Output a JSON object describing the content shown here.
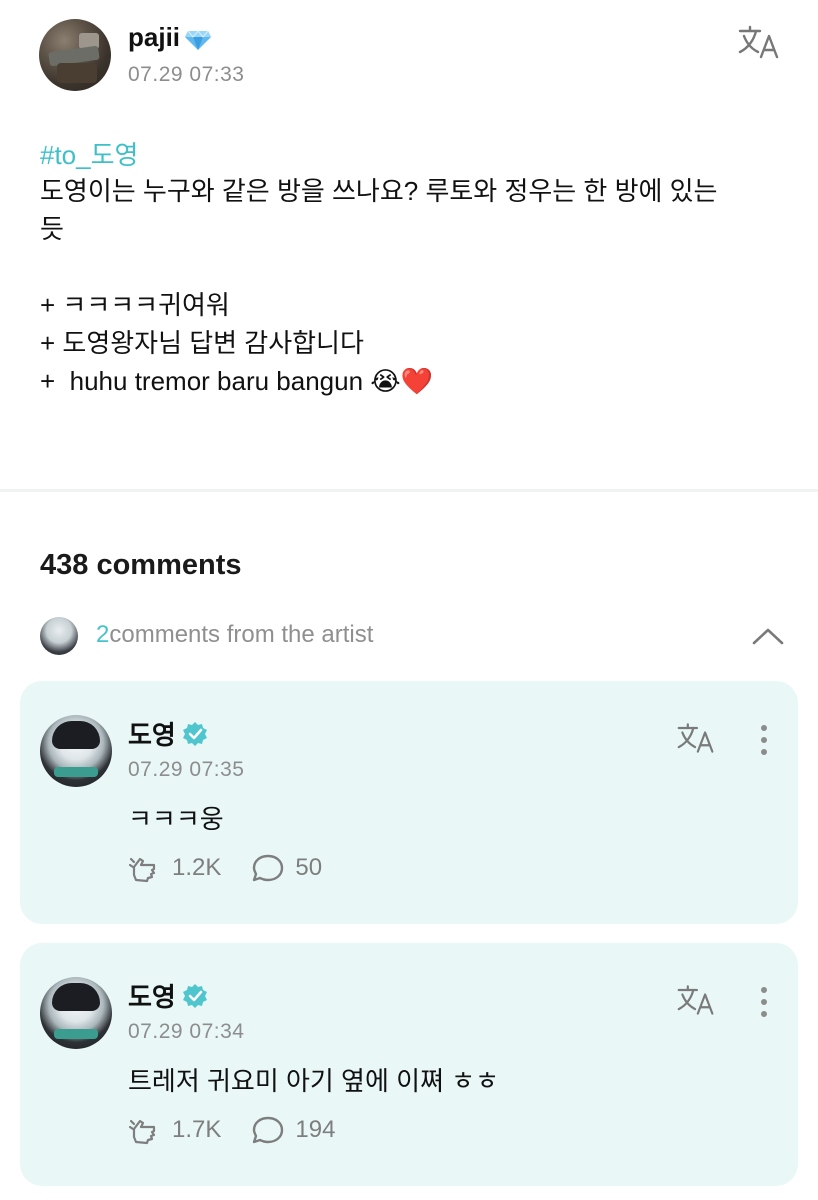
{
  "post": {
    "username": "pajii",
    "badge_icon": "diamond-gem-icon",
    "timestamp": "07.29 07:33",
    "hashtag": "#to_도영",
    "body_lines": [
      "도영이는 누구와 같은 방을 쓰나요? 루토와 정우는 한 방에 있는",
      "듯",
      "",
      "+ ㅋㅋㅋㅋ귀여워",
      "+ 도영왕자님 답변 감사합니다",
      "+  huhu tremor baru bangun 😭❤️"
    ]
  },
  "comments_section": {
    "count_label": "438 comments",
    "artist_count": "2",
    "artist_label": "comments from the artist",
    "comments": [
      {
        "name": "도영",
        "timestamp": "07.29 07:35",
        "text": "ㅋㅋㅋ웅",
        "likes": "1.2K",
        "replies": "50"
      },
      {
        "name": "도영",
        "timestamp": "07.29 07:34",
        "text": "트레저 귀요미 아기 옆에 이쪄 ㅎㅎ",
        "likes": "1.7K",
        "replies": "194"
      }
    ]
  },
  "colors": {
    "accent": "#3fc0c9",
    "card_bg": "#e9f8f7",
    "muted": "#8d8d8d"
  }
}
